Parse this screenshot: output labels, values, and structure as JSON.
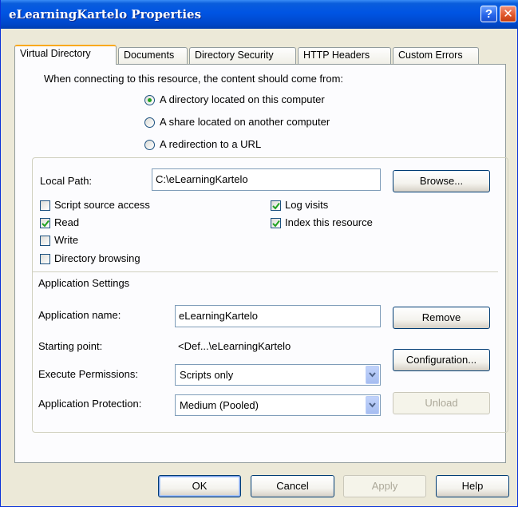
{
  "window": {
    "title": "eLearningKartelo Properties"
  },
  "titlebar_buttons": {
    "help": "?",
    "close": "✕"
  },
  "tabs": [
    {
      "label": "Virtual Directory",
      "active": true
    },
    {
      "label": "Documents"
    },
    {
      "label": "Directory Security"
    },
    {
      "label": "HTTP Headers"
    },
    {
      "label": "Custom Errors"
    }
  ],
  "content_source": {
    "prompt": "When connecting to this resource, the content should come from:",
    "options": [
      {
        "label": "A directory located on this computer",
        "selected": true
      },
      {
        "label": "A share located on another computer",
        "selected": false
      },
      {
        "label": "A redirection to a URL",
        "selected": false
      }
    ]
  },
  "local_path": {
    "label": "Local Path:",
    "value": "C:\\eLearningKartelo",
    "browse_label": "Browse..."
  },
  "permissions": [
    {
      "label": "Script source access",
      "checked": false
    },
    {
      "label": "Read",
      "checked": true
    },
    {
      "label": "Write",
      "checked": false
    },
    {
      "label": "Directory browsing",
      "checked": false
    },
    {
      "label": "Log visits",
      "checked": true
    },
    {
      "label": "Index this resource",
      "checked": true
    }
  ],
  "app_settings": {
    "heading": "Application Settings",
    "name_label": "Application name:",
    "name_value": "eLearningKartelo",
    "remove_label": "Remove",
    "starting_point_label": "Starting point:",
    "starting_point_value": "<Def...\\eLearningKartelo",
    "configuration_label": "Configuration...",
    "execute_label": "Execute Permissions:",
    "execute_value": "Scripts only",
    "protection_label": "Application Protection:",
    "protection_value": "Medium (Pooled)",
    "unload_label": "Unload"
  },
  "footer": {
    "ok": "OK",
    "cancel": "Cancel",
    "apply": "Apply",
    "help": "Help"
  },
  "colors": {
    "titlebar": "#0054e3",
    "dialog_bg": "#ece9d8",
    "panel_bg": "#fcfcfe",
    "check_green": "#21a121",
    "tab_accent": "#f9a91e"
  }
}
